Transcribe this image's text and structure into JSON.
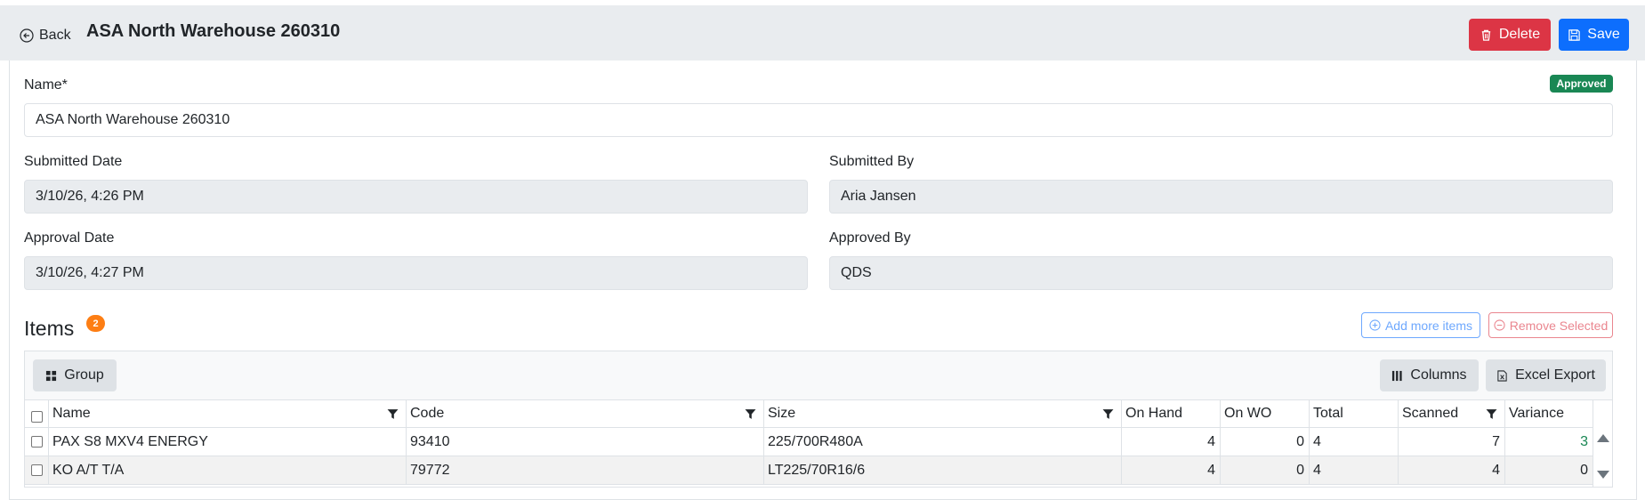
{
  "header": {
    "back_label": "Back",
    "title": "ASA North Warehouse 260310",
    "delete_label": "Delete",
    "save_label": "Save"
  },
  "form": {
    "status": "Approved",
    "name_label": "Name*",
    "name_value": "ASA North Warehouse 260310",
    "submitted_date_label": "Submitted Date",
    "submitted_date_value": "3/10/26, 4:26 PM",
    "submitted_by_label": "Submitted By",
    "submitted_by_value": "Aria Jansen",
    "approval_date_label": "Approval Date",
    "approval_date_value": "3/10/26, 4:27 PM",
    "approved_by_label": "Approved By",
    "approved_by_value": "QDS"
  },
  "items": {
    "title": "Items",
    "count": "2",
    "add_label": "Add more items",
    "remove_label": "Remove Selected",
    "toolbar": {
      "group_label": "Group",
      "columns_label": "Columns",
      "export_label": "Excel Export"
    },
    "columns": [
      "Name",
      "Code",
      "Size",
      "On Hand",
      "On WO",
      "Total",
      "Scanned",
      "Variance"
    ],
    "rows": [
      {
        "name": "PAX S8 MXV4 ENERGY",
        "code": "93410",
        "size": "225/700R480A",
        "on_hand": "4",
        "on_wo": "0",
        "total": "4",
        "scanned": "7",
        "variance": "3"
      },
      {
        "name": "KO A/T T/A",
        "code": "79772",
        "size": "LT225/70R16/6",
        "on_hand": "4",
        "on_wo": "0",
        "total": "4",
        "scanned": "4",
        "variance": "0"
      }
    ]
  },
  "colors": {
    "danger": "#dc3545",
    "primary": "#0d6efd",
    "success": "#198754",
    "badge_orange": "#fd7e14"
  }
}
